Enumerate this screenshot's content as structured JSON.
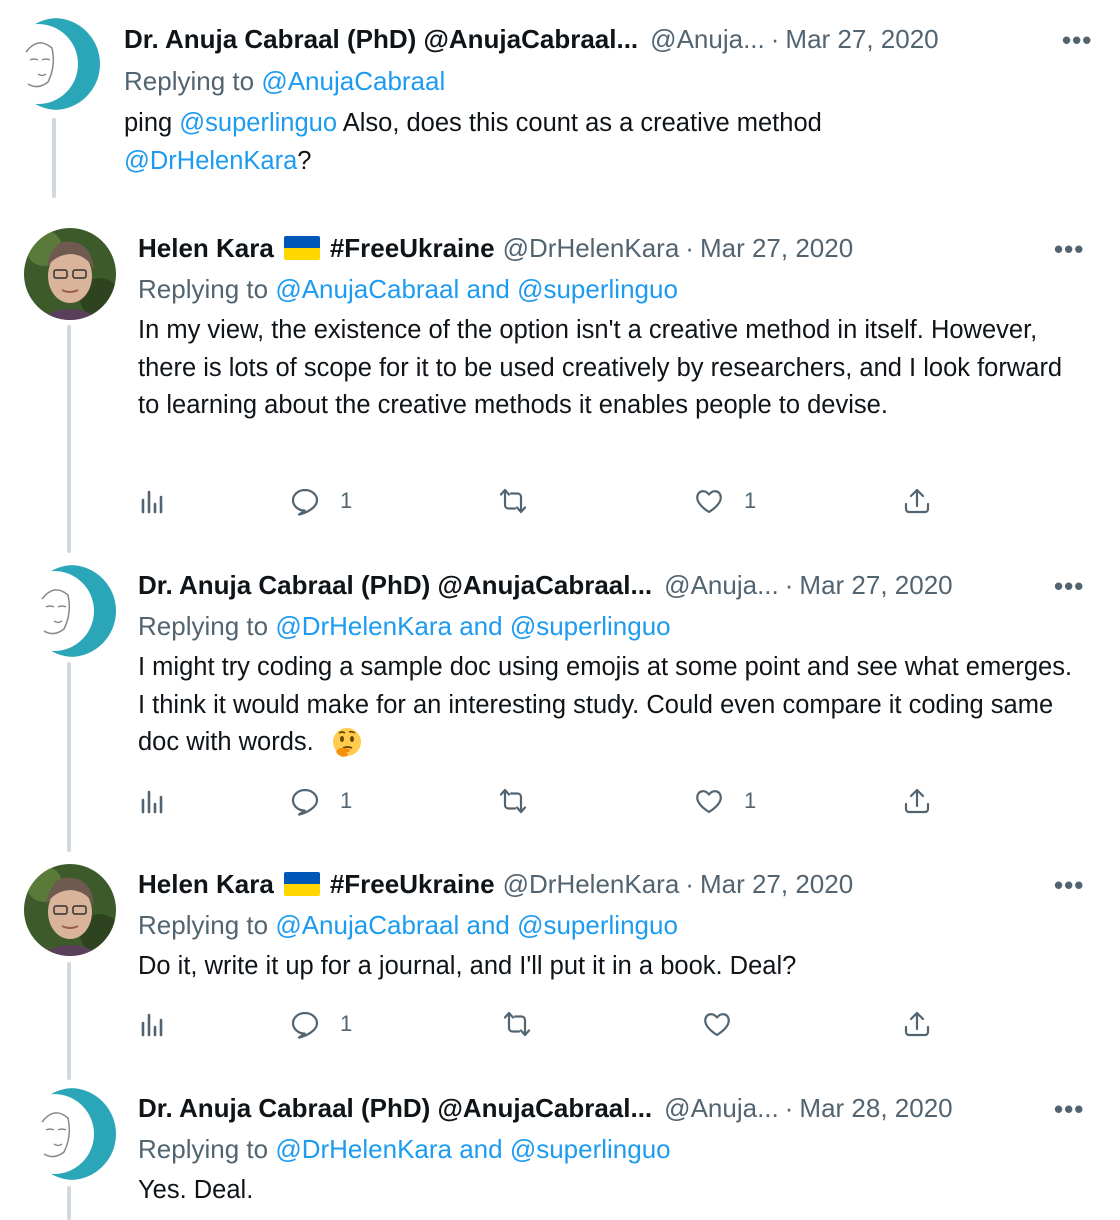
{
  "tweets": [
    {
      "name": "Dr. Anuja Cabraal (PhD) @AnujaCabraal...",
      "handle": "@Anuja...",
      "date": "Mar 27, 2020",
      "replying_label": "Replying to",
      "replying_to": "@AnujaCabraal",
      "body_parts": [
        "ping ",
        "@superlinguo",
        "  Also, does this count as a creative method ",
        "@DrHelenKara",
        "?"
      ]
    },
    {
      "name": "Helen Kara",
      "hashtag": "#FreeUkraine",
      "handle": "@DrHelenKara",
      "date": "Mar 27, 2020",
      "replying_label": "Replying to",
      "replying_to": "@AnujaCabraal and @superlinguo",
      "body": "In my view, the existence of the option isn't a creative method in itself. However, there is lots of scope for it to be used creatively by researchers, and I look forward to learning about the creative methods it enables people to devise.",
      "replies": "1",
      "likes": "1"
    },
    {
      "name": "Dr. Anuja Cabraal (PhD) @AnujaCabraal...",
      "handle": "@Anuja...",
      "date": "Mar 27, 2020",
      "replying_label": "Replying to",
      "replying_to": "@DrHelenKara and @superlinguo",
      "body": "I might try coding a sample doc using emojis at some point and see what emerges.  I think it would make for an interesting study. Could even compare it coding same doc with words.",
      "emoji": "thinking-face-emoji",
      "replies": "1",
      "likes": "1"
    },
    {
      "name": "Helen Kara",
      "hashtag": "#FreeUkraine",
      "handle": "@DrHelenKara",
      "date": "Mar 27, 2020",
      "replying_label": "Replying to",
      "replying_to": "@AnujaCabraal and @superlinguo",
      "body": "Do it, write it up for a journal, and I'll put it in a book. Deal?",
      "replies": "1",
      "likes": ""
    },
    {
      "name": "Dr. Anuja Cabraal (PhD) @AnujaCabraal...",
      "handle": "@Anuja...",
      "date": "Mar 28, 2020",
      "replying_label": "Replying to",
      "replying_to": "@DrHelenKara and @superlinguo",
      "body": "Yes. Deal."
    }
  ],
  "ui": {
    "separator": "·",
    "more": "•••"
  },
  "colors": {
    "link": "#1d9bf0",
    "muted": "#536471",
    "thread_line": "#cfd9de",
    "avatar_teal": "#2aa6b8"
  }
}
